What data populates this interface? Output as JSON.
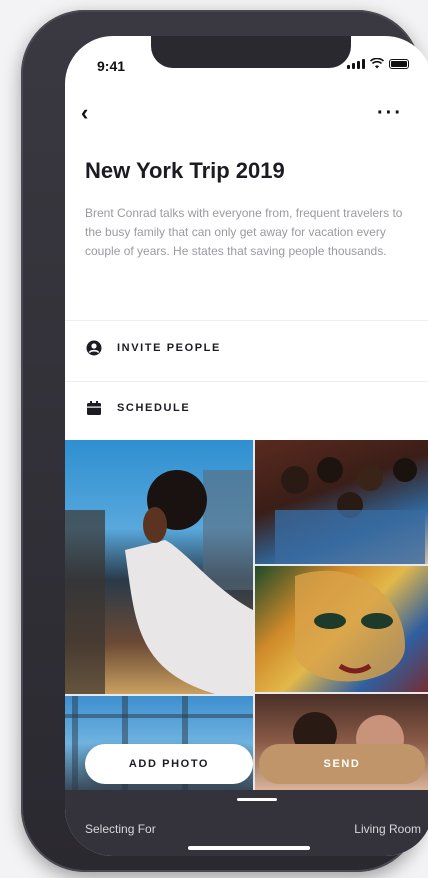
{
  "status_bar": {
    "time": "9:41"
  },
  "header": {
    "back_icon": "chevron-left-icon",
    "back_glyph": "‹",
    "more_icon": "more-horizontal-icon",
    "more_glyph": "···"
  },
  "trip": {
    "title": "New York Trip 2019",
    "description": "Brent Conrad talks with everyone from, frequent travelers to the busy family that can only get away for vacation every couple of years. He states that saving people thousands."
  },
  "actions": [
    {
      "label": "INVITE PEOPLE",
      "icon": "person-circle-icon"
    },
    {
      "label": "SCHEDULE",
      "icon": "calendar-icon"
    }
  ],
  "buttons": {
    "add_photo": "ADD PHOTO",
    "send": "SEND"
  },
  "bottom_bar": {
    "selecting_label": "Selecting For",
    "room_label": "Living Room"
  },
  "colors": {
    "accent": "#c0956a",
    "bottom_bar": "#34323a",
    "phone_frame": "#2b2930"
  }
}
